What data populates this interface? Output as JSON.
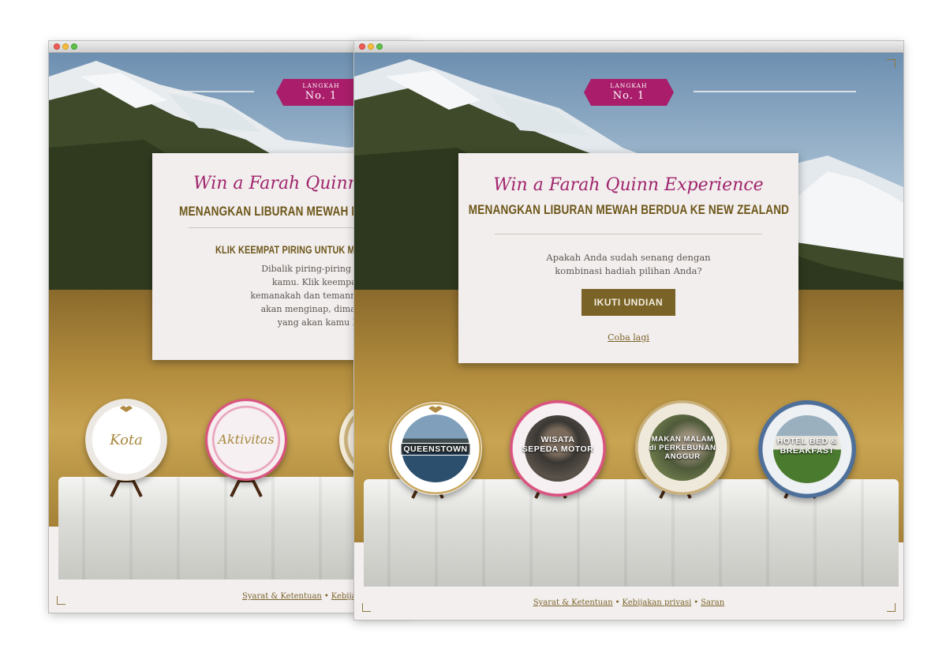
{
  "back_window": {
    "badge": {
      "line1": "LANGKAH",
      "line2": "No. 1"
    },
    "title_script": "Win a Farah Quinn",
    "title_caps": "MENANGKAN LIBURAN MEWAH BERDU",
    "subheading": "KLIK KEEMPAT PIRING UNTUK MELIH",
    "body_lines": [
      "Dibalik piring-piring ini adalah rinc",
      "kamu. Klik keempat piring untuk",
      "kemanakah dan temanmu di New Zea",
      "akan menginap, dimana kamu akan",
      "yang akan kamu lakukan. Semo"
    ],
    "plates": [
      {
        "label": "Kota"
      },
      {
        "label": "Aktivitas"
      }
    ],
    "footer": {
      "link1": "Syarat & Ketentuan",
      "sep": "•",
      "link2": "Kebijakan pri"
    }
  },
  "front_window": {
    "badge": {
      "line1": "LANGKAH",
      "line2": "No. 1"
    },
    "title_script": "Win a Farah Quinn Experience",
    "title_caps": "MENANGKAN LIBURAN MEWAH BERDUA KE NEW ZEALAND",
    "question": "Apakah Anda sudah senang dengan kombinasi hadiah pilihan Anda?",
    "cta_button": "IKUTI UNDIAN",
    "retry_link": "Coba lagi",
    "plates": [
      {
        "line1": "QUEENSTOWN",
        "line2": ""
      },
      {
        "line1": "WISATA",
        "line2": "SEPEDA MOTOR"
      },
      {
        "line1": "MAKAN MALAM",
        "line2": "di PERKEBUNAN ANGGUR"
      },
      {
        "line1": "HOTEL BED &",
        "line2": "BREAKFAST"
      }
    ],
    "footer": {
      "link1": "Syarat & Ketentuan",
      "sep1": "•",
      "link2": "Kebijakan privasi",
      "sep2": "•",
      "link3": "Saran"
    }
  },
  "colors": {
    "accent_magenta": "#a91d6a",
    "brand_gold": "#7a6326",
    "card_bg": "#f2eeee"
  },
  "icons": [
    "window-close-dot-icon",
    "window-minimize-dot-icon",
    "window-zoom-dot-icon",
    "corner-bracket-icon",
    "crest-icon",
    "plate-stand-icon"
  ]
}
